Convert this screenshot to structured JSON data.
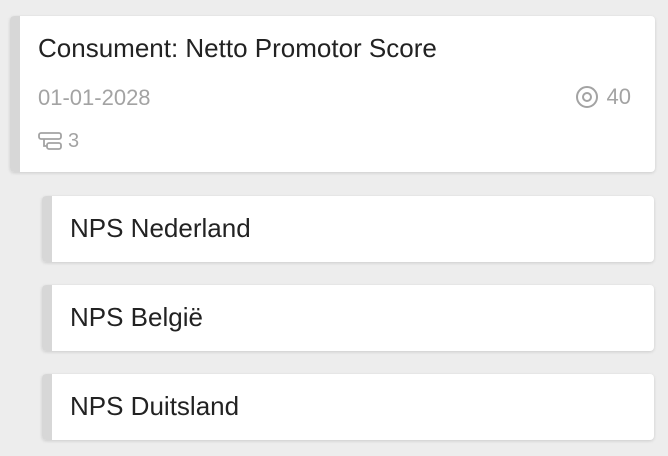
{
  "main_card": {
    "title": "Consument: Netto Promotor Score",
    "date": "01-01-2028",
    "views_icon": "eye-icon",
    "views_count": "40",
    "subtasks_icon": "subtasks-icon",
    "subtasks_count": "3"
  },
  "child_cards": [
    {
      "label": "NPS Nederland"
    },
    {
      "label": "NPS België"
    },
    {
      "label": "NPS Duitsland"
    }
  ],
  "colors": {
    "background": "#ededed",
    "card": "#ffffff",
    "stripe": "#d7d7d7",
    "title_text": "#222222",
    "meta_text": "#a3a3a3"
  }
}
